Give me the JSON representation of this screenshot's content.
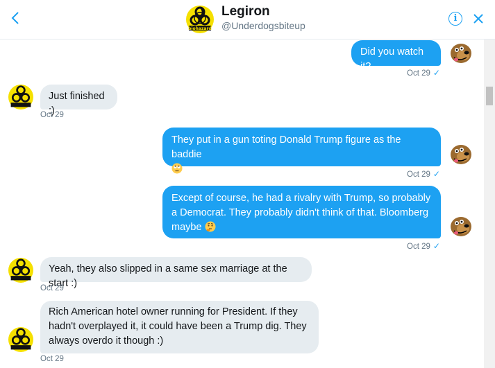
{
  "header": {
    "back_icon": "chevron-left-icon",
    "name": "Legiron",
    "handle": "@Underdogsbiteup",
    "info_icon": "i",
    "close_icon": "✕",
    "avatar_icon": "biohazard-icon"
  },
  "colors": {
    "accent": "#1da1f2",
    "incoming_bubble": "#e6ecf0",
    "text": "#14171a",
    "secondary_text": "#657786"
  },
  "messages": [
    {
      "direction": "out",
      "text": "Did you watch it?",
      "time": "Oct 29",
      "check": "✓"
    },
    {
      "direction": "in",
      "text": "Just finished :)",
      "time": "Oct 29"
    },
    {
      "direction": "out",
      "text": "They put in a gun toting Donald Trump figure as the baddie",
      "emoji": "eye-roll-emoji",
      "time": "Oct 29",
      "check": "✓"
    },
    {
      "direction": "out",
      "text": "Except of course, he had a rivalry with Trump, so probably a Democrat. They probably didn't think of that. Bloomberg maybe",
      "emoji": "thinking-emoji",
      "time": "Oct 29",
      "check": "✓"
    },
    {
      "direction": "in",
      "text": "Yeah, they also slipped in a same sex marriage at the start :)",
      "time": "Oct 29"
    },
    {
      "direction": "in",
      "text": "Rich American hotel owner running for President.  If they hadn't overplayed it, it could have been a Trump dig. They always overdo it though :)",
      "time": "Oct 29"
    }
  ]
}
